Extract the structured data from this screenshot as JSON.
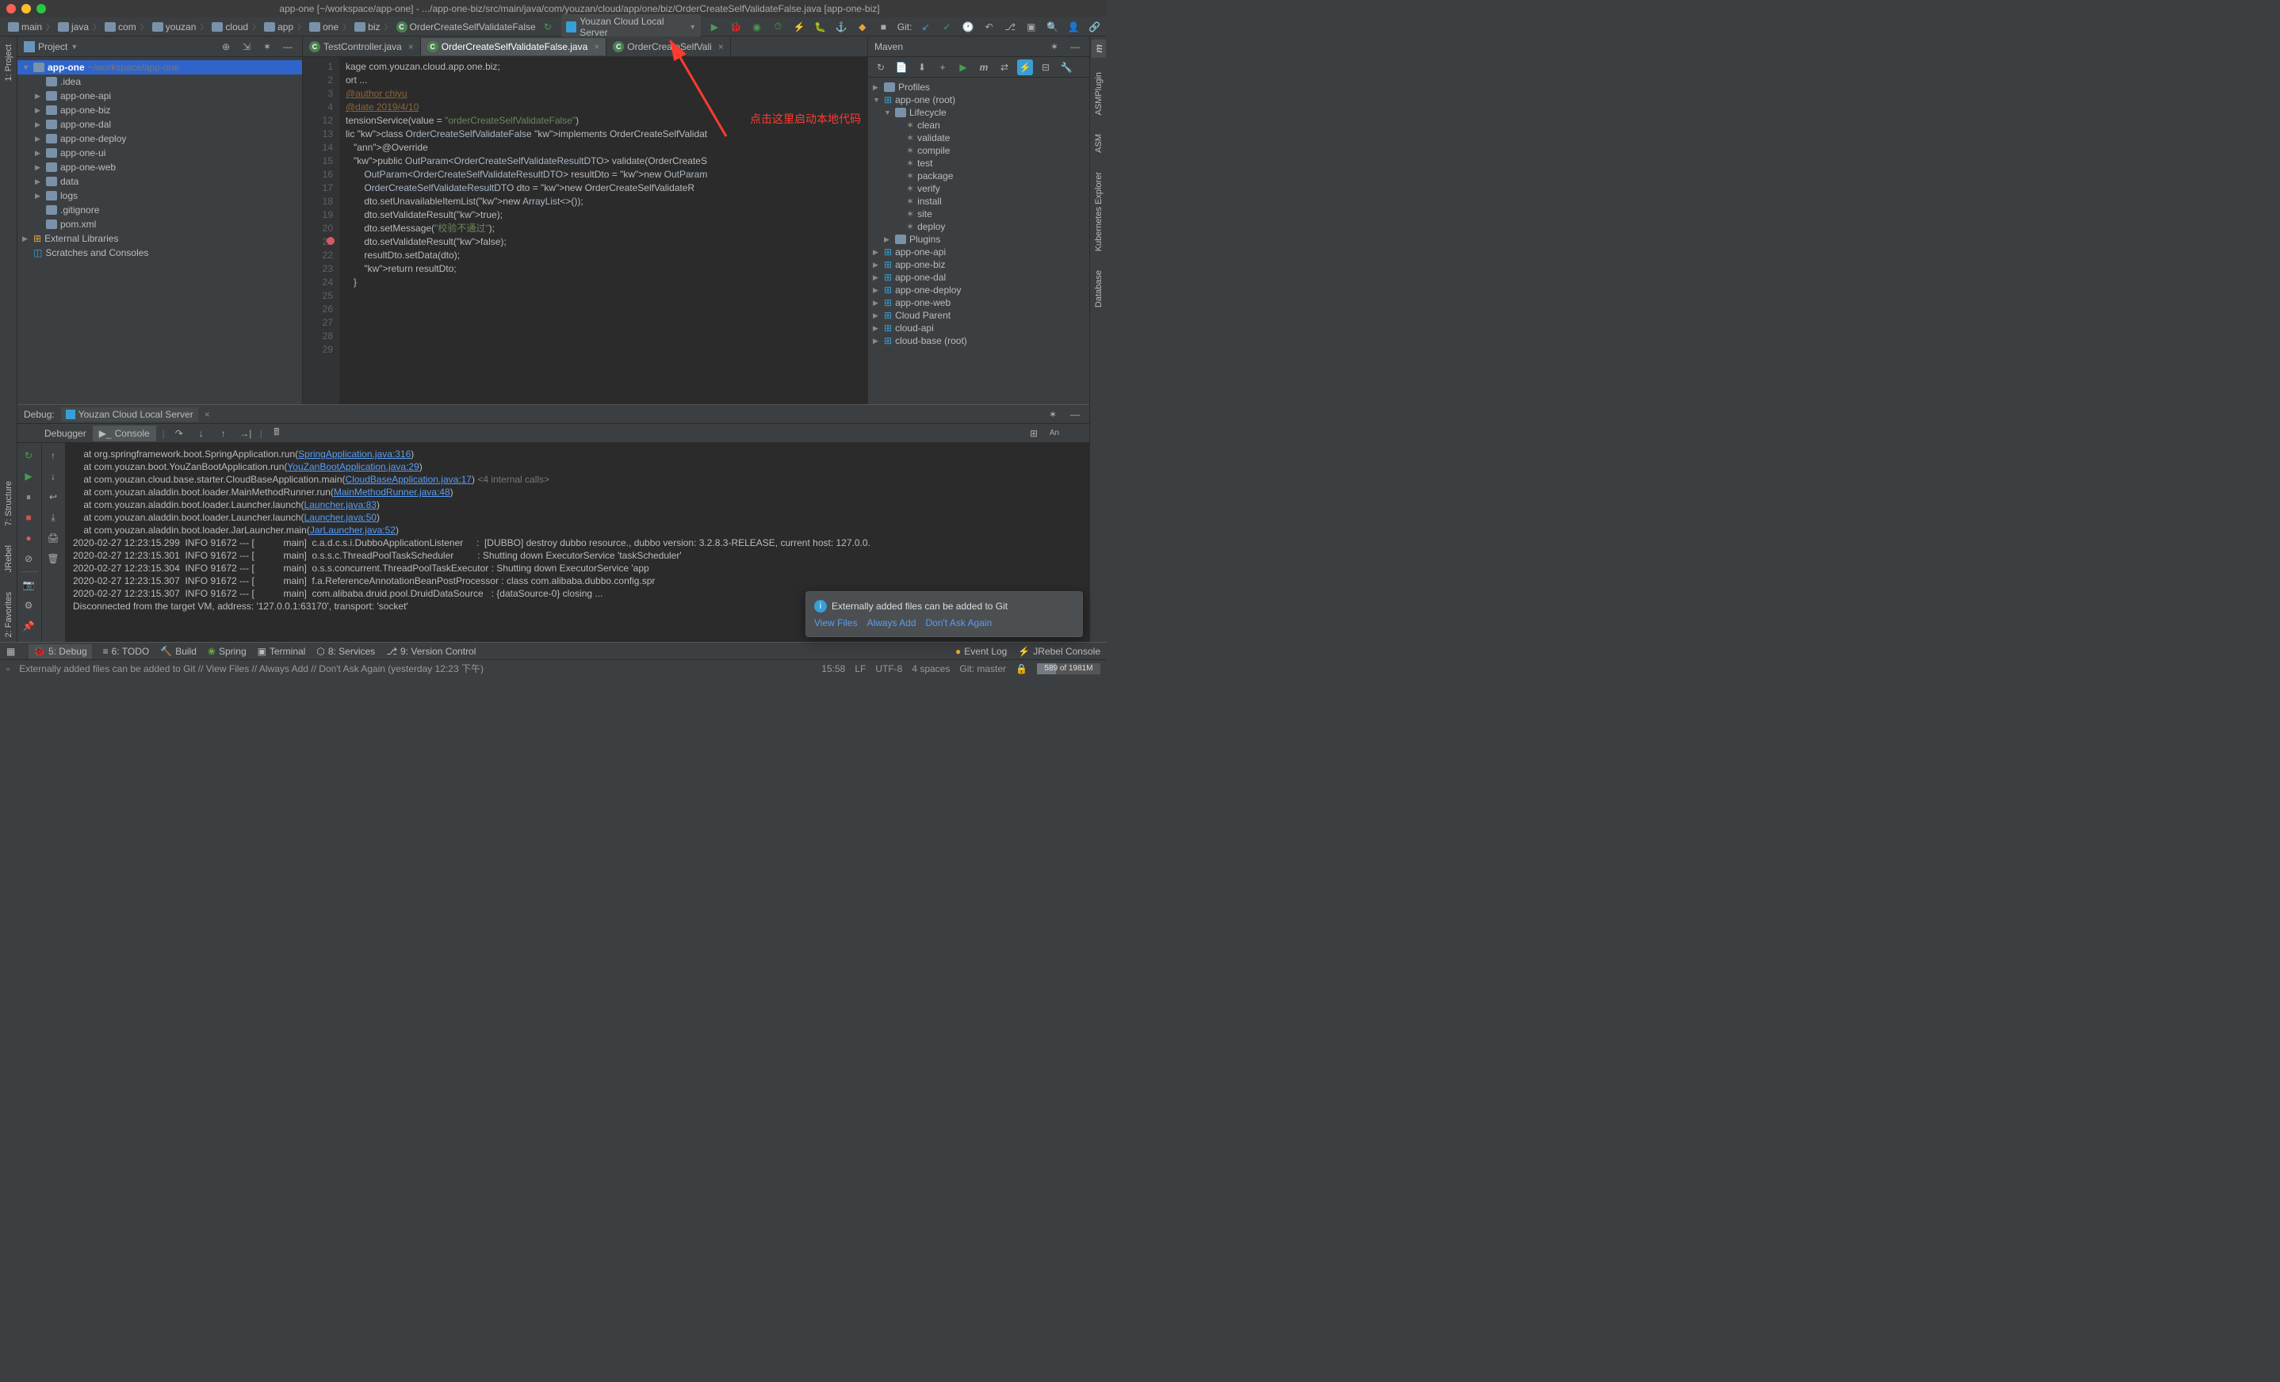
{
  "title": "app-one [~/workspace/app-one] - .../app-one-biz/src/main/java/com/youzan/cloud/app/one/biz/OrderCreateSelfValidateFalse.java [app-one-biz]",
  "breadcrumbs": [
    "main",
    "java",
    "com",
    "youzan",
    "cloud",
    "app",
    "one",
    "biz",
    "OrderCreateSelfValidateFalse"
  ],
  "runConfig": "Youzan Cloud Local Server",
  "gitLabel": "Git:",
  "project": {
    "panel_label": "Project",
    "root": "app-one",
    "rootPath": "~/workspace/app-one",
    "items": [
      ".idea",
      "app-one-api",
      "app-one-biz",
      "app-one-dal",
      "app-one-deploy",
      "app-one-ui",
      "app-one-web",
      "data",
      "logs",
      ".gitignore",
      "pom.xml"
    ],
    "libs": "External Libraries",
    "scratches": "Scratches and Consoles"
  },
  "tabs": [
    {
      "label": "TestController.java",
      "active": false
    },
    {
      "label": "OrderCreateSelfValidateFalse.java",
      "active": true
    },
    {
      "label": "OrderCreateSelfVali",
      "active": false
    }
  ],
  "code": {
    "start": 1,
    "lines": [
      "kage com.youzan.cloud.app.one.biz;",
      "",
      "ort ...",
      "",
      "",
      "@author chiyu",
      "@date 2019/4/10",
      "",
      "tensionService(value = \"orderCreateSelfValidateFalse\")",
      "lic class OrderCreateSelfValidateFalse implements OrderCreateSelfValidat",
      "",
      "   @Override",
      "   public OutParam<OrderCreateSelfValidateResultDTO> validate(OrderCreateS",
      "       OutParam<OrderCreateSelfValidateResultDTO> resultDto = new OutParam",
      "       OrderCreateSelfValidateResultDTO dto = new OrderCreateSelfValidateR",
      "       dto.setUnavailableItemList(new ArrayList<>());",
      "       dto.setValidateResult(true);",
      "       dto.setMessage(\"校验不通过\");",
      "       dto.setValidateResult(false);",
      "       resultDto.setData(dto);",
      "       return resultDto;",
      "   }",
      ""
    ],
    "lineNums": [
      "1",
      "2",
      "3",
      "4",
      "",
      "12",
      "13",
      "14",
      "15",
      "16",
      "17",
      "18",
      "19",
      "20",
      "21",
      "22",
      "23",
      "24",
      "25",
      "26",
      "27",
      "28",
      "29"
    ],
    "breadcrumb": "OrderCreateSelfValidateFalse"
  },
  "maven": {
    "label": "Maven",
    "profiles": "Profiles",
    "root": "app-one (root)",
    "lifecycle": "Lifecycle",
    "phases": [
      "clean",
      "validate",
      "compile",
      "test",
      "package",
      "verify",
      "install",
      "site",
      "deploy"
    ],
    "plugins": "Plugins",
    "modules": [
      "app-one-api",
      "app-one-biz",
      "app-one-dal",
      "app-one-deploy",
      "app-one-web",
      "Cloud Parent",
      "cloud-api",
      "cloud-base (root)"
    ]
  },
  "debug": {
    "label": "Debug:",
    "config": "Youzan Cloud Local Server",
    "tabDebugger": "Debugger",
    "tabConsole": "Console",
    "lines": [
      "    at org.springframework.boot.SpringApplication.run(SpringApplication.java:316)",
      "    at com.youzan.boot.YouZanBootApplication.run(YouZanBootApplication.java:29)",
      "    at com.youzan.cloud.base.starter.CloudBaseApplication.main(CloudBaseApplication.java:17) <4 internal calls>",
      "    at com.youzan.aladdin.boot.loader.MainMethodRunner.run(MainMethodRunner.java:48)",
      "    at com.youzan.aladdin.boot.loader.Launcher.launch(Launcher.java:83)",
      "    at com.youzan.aladdin.boot.loader.Launcher.launch(Launcher.java:50)",
      "    at com.youzan.aladdin.boot.loader.JarLauncher.main(JarLauncher.java:52)",
      "",
      "2020-02-27 12:23:15.299  INFO 91672 --- [           main]  c.a.d.c.s.i.DubboApplicationListener     :  [DUBBO] destroy dubbo resource., dubbo version: 3.2.8.3-RELEASE, current host: 127.0.0.",
      "2020-02-27 12:23:15.301  INFO 91672 --- [           main]  o.s.s.c.ThreadPoolTaskScheduler         : Shutting down ExecutorService 'taskScheduler'",
      "2020-02-27 12:23:15.304  INFO 91672 --- [           main]  o.s.s.concurrent.ThreadPoolTaskExecutor : Shutting down ExecutorService 'app",
      "2020-02-27 12:23:15.307  INFO 91672 --- [           main]  f.a.ReferenceAnnotationBeanPostProcessor : class com.alibaba.dubbo.config.spr",
      "2020-02-27 12:23:15.307  INFO 91672 --- [           main]  com.alibaba.druid.pool.DruidDataSource   : {dataSource-0} closing ...",
      "Disconnected from the target VM, address: '127.0.0.1:63170', transport: 'socket'"
    ]
  },
  "bottom": [
    "5: Debug",
    "6: TODO",
    "Build",
    "Spring",
    "Terminal",
    "8: Services",
    "9: Version Control"
  ],
  "bottomRight": [
    "Event Log",
    "JRebel Console"
  ],
  "status": {
    "msg": "Externally added files can be added to Git // View Files // Always Add // Don't Ask Again (yesterday 12:23 下午)",
    "pos": "15:58",
    "le": "LF",
    "enc": "UTF-8",
    "indent": "4 spaces",
    "branch": "Git: master",
    "mem": "589 of 1981M"
  },
  "notif": {
    "title": "Externally added files can be added to Git",
    "links": [
      "View Files",
      "Always Add",
      "Don't Ask Again"
    ]
  },
  "annotation": "点击这里启动本地代码",
  "leftStrip": [
    "1: Project",
    "7: Structure",
    "JRebel",
    "2: Favorites"
  ],
  "rightStrip": [
    "Maven",
    "ASMPlugin",
    "ASM",
    "Kubernetes Explorer",
    "Database"
  ]
}
